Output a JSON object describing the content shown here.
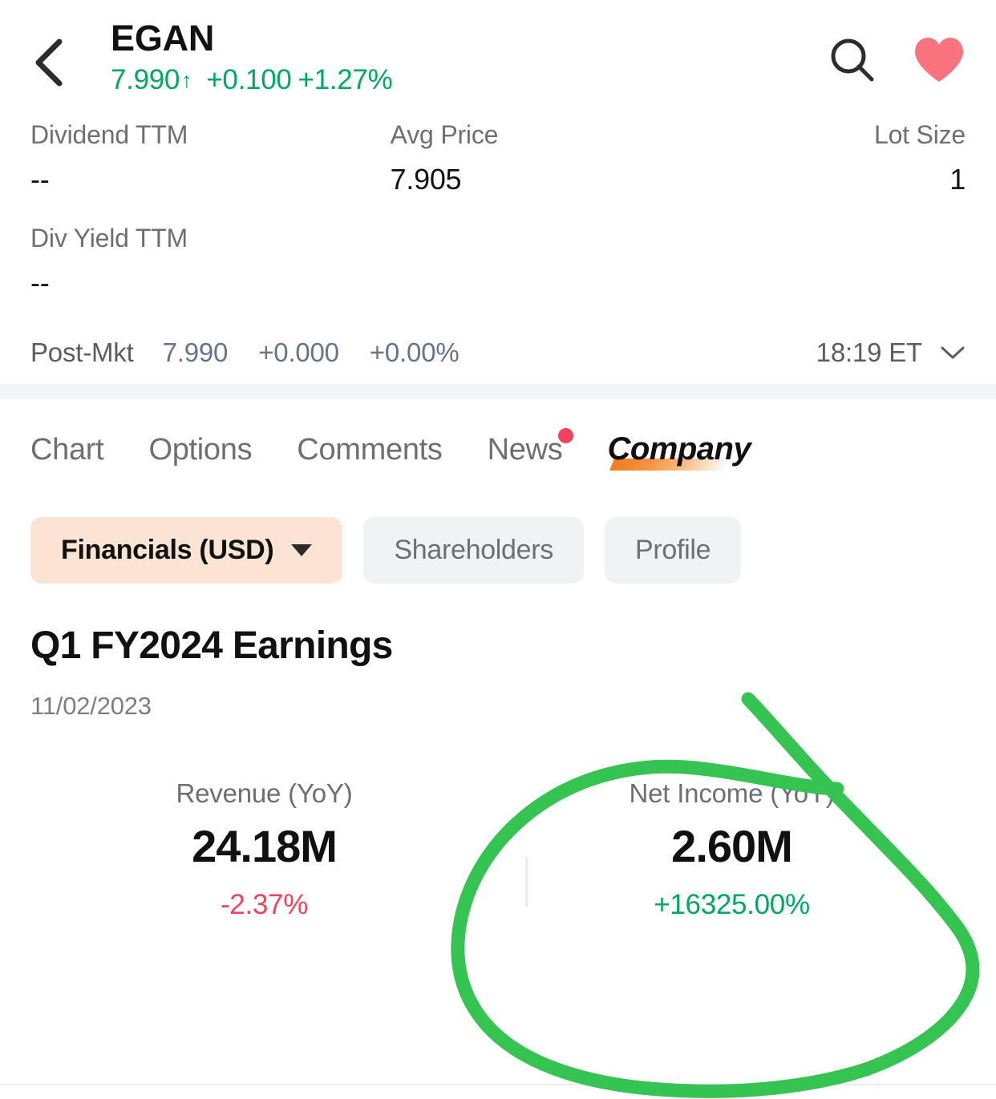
{
  "header": {
    "back_icon": "chevron-left-icon",
    "ticker": "EGAN",
    "price": "7.990",
    "direction_arrow": "↑",
    "change_abs": "+0.100",
    "change_pct": "+1.27%",
    "quote_color": "#00a862",
    "search_icon": "search-icon",
    "favorite_icon": "heart-icon",
    "favorite_color": "#f9737f"
  },
  "stats": {
    "row1": [
      {
        "label": "Dividend TTM",
        "value": "--"
      },
      {
        "label": "Avg Price",
        "value": "7.905"
      },
      {
        "label": "Lot Size",
        "value": "1"
      }
    ],
    "row2": [
      {
        "label": "Div Yield TTM",
        "value": "--"
      }
    ]
  },
  "post_market": {
    "label": "Post-Mkt",
    "price": "7.990",
    "change_abs": "+0.000",
    "change_pct": "+0.00%",
    "time": "18:19 ET",
    "chevron_icon": "chevron-down-icon",
    "value_color": "#66748a"
  },
  "tabs": [
    {
      "label": "Chart",
      "active": false,
      "badge": false
    },
    {
      "label": "Options",
      "active": false,
      "badge": false
    },
    {
      "label": "Comments",
      "active": false,
      "badge": false
    },
    {
      "label": "News",
      "active": false,
      "badge": true
    },
    {
      "label": "Company",
      "active": true,
      "badge": false
    }
  ],
  "pills": [
    {
      "label": "Financials (USD)",
      "active": true,
      "caret": true
    },
    {
      "label": "Shareholders",
      "active": false,
      "caret": false
    },
    {
      "label": "Profile",
      "active": false,
      "caret": false
    }
  ],
  "earnings": {
    "title": "Q1 FY2024 Earnings",
    "date": "11/02/2023",
    "metrics": [
      {
        "label": "Revenue (YoY)",
        "value": "24.18M",
        "change": "-2.37%",
        "change_sign": "negative"
      },
      {
        "label": "Net Income (YoY)",
        "value": "2.60M",
        "change": "+16325.00%",
        "change_sign": "positive"
      }
    ]
  },
  "annotation": {
    "type": "hand-drawn-circle",
    "color": "#35c352",
    "target": "Net Income (YoY)"
  }
}
